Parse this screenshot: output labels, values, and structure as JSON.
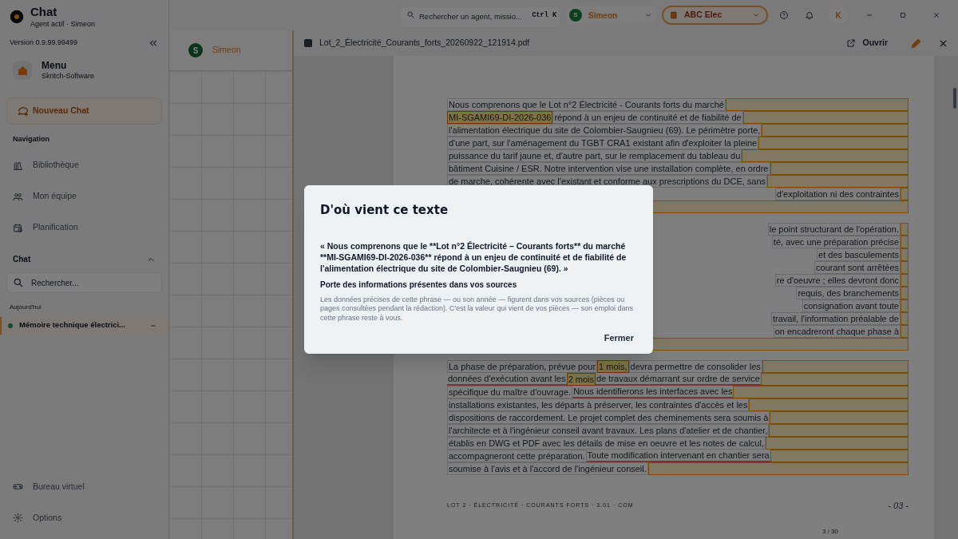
{
  "app": {
    "title": "Chat",
    "subtitle": "Agent actif · Simeon"
  },
  "top_bar": {
    "search": {
      "placeholder": "Rechercher un agent, missio...",
      "shortcut": "Ctrl K"
    },
    "user": {
      "initial": "S",
      "name": "Simeon"
    },
    "organization": {
      "name": "ABC Elec"
    },
    "account_initial": "K"
  },
  "sidebar": {
    "version": "Version 0.9.99.99499",
    "menu": {
      "title": "Menu",
      "subtitle": "Skritch-Software"
    },
    "new_chat": "Nouveau Chat",
    "navigation_label": "Navigation",
    "navigation": [
      {
        "kind": "library",
        "label": "Bibliothèque"
      },
      {
        "kind": "team",
        "label": "Mon équipe"
      },
      {
        "kind": "calendar",
        "label": "Planification"
      }
    ],
    "chat_section": {
      "label": "Chat",
      "expanded": true,
      "search_placeholder": "Rechercher...",
      "group": "Aujourd'hui",
      "conversations": [
        {
          "title": "Mémoire technique électrici...",
          "selected": true
        }
      ]
    },
    "bottom": [
      {
        "kind": "gamepad",
        "label": "Bureau virtuel"
      },
      {
        "kind": "gear",
        "label": "Options"
      }
    ]
  },
  "canvas_panel": {
    "agent": {
      "initial": "S",
      "name": "Simeon"
    }
  },
  "document": {
    "file_name": "Lot_2_Électricité_Courants_forts_20260922_121914.pdf",
    "open_button": "Ouvrir",
    "paragraphs": [
      {
        "lines": [
          {
            "cut_left": false,
            "segments": [
              {
                "kind": "plain",
                "text": "Nous comprenons que le Lot n°2 Électricité - Courants forts du marché"
              }
            ]
          },
          {
            "cut_left": false,
            "segments": [
              {
                "kind": "highlight",
                "text": "MI-SGAMI69-DI-2026-036"
              },
              {
                "kind": "plain",
                "text": " répond à un enjeu de continuité et de fiabilité de"
              }
            ]
          },
          {
            "cut_left": false,
            "segments": [
              {
                "kind": "plain",
                "text": "l'alimentation électrique du site de Colombier-Saugnieu (69). Le périmètre porte,"
              }
            ]
          },
          {
            "cut_left": false,
            "segments": [
              {
                "kind": "plain",
                "text": "d'une part, sur l'aménagement du TGBT CRA1 existant afin d'exploiter la pleine"
              }
            ]
          },
          {
            "cut_left": false,
            "segments": [
              {
                "kind": "plain",
                "text": "puissance du tarif jaune et, d'autre part, sur le remplacement du tableau du"
              }
            ]
          },
          {
            "cut_left": false,
            "segments": [
              {
                "kind": "plain",
                "text": "bâtiment Cuisine / ESR. Notre intervention vise une installation complète, en ordre"
              }
            ]
          },
          {
            "cut_left": false,
            "segments": [
              {
                "kind": "plain",
                "text": "de marche, cohérente avec l'existant et conforme aux prescriptions du DCE, sans"
              }
            ]
          },
          {
            "cut_left": true,
            "segments": [
              {
                "kind": "plain",
                "text": "d'exploitation ni des contraintes"
              }
            ]
          },
          {
            "cut_left": false
          }
        ]
      },
      {
        "lines": [
          {
            "cut_left": true,
            "segments": [
              {
                "kind": "plain",
                "text": "le point structurant de l'opération."
              }
            ]
          },
          {
            "cut_left": true,
            "segments": [
              {
                "kind": "plain",
                "text": "té, avec une préparation précise"
              }
            ]
          },
          {
            "cut_left": true,
            "segments": [
              {
                "kind": "plain",
                "text": "et des basculements"
              }
            ]
          },
          {
            "cut_left": true,
            "segments": [
              {
                "kind": "plain",
                "text": "courant sont arrêtées"
              }
            ]
          },
          {
            "cut_left": true,
            "segments": [
              {
                "kind": "plain",
                "text": "re d'oeuvre ; elles devront donc"
              }
            ]
          },
          {
            "cut_left": true,
            "segments": [
              {
                "kind": "plain",
                "text": "requis, des branchements"
              }
            ]
          },
          {
            "cut_left": true,
            "segments": [
              {
                "kind": "plain",
                "text": "consignation avant toute"
              }
            ]
          },
          {
            "cut_left": true,
            "segments": [
              {
                "kind": "plain",
                "text": "travail, l'information préalable de"
              }
            ]
          },
          {
            "cut_left": true,
            "segments": [
              {
                "kind": "plain",
                "text": "on encadreront chaque phase à"
              }
            ]
          },
          {
            "cut_left": false
          }
        ]
      },
      {
        "lines": [
          {
            "cut_left": false,
            "segments": [
              {
                "kind": "plain",
                "text": "La phase de préparation, prévue pour "
              },
              {
                "kind": "highlight",
                "text": "1 mois,"
              },
              {
                "kind": "plain",
                "text": " devra permettre de consolider les"
              }
            ]
          },
          {
            "cut_left": false,
            "segments": [
              {
                "kind": "underline",
                "text": "données d'exécution avant les "
              },
              {
                "kind": "highlight",
                "text": "2 mois"
              },
              {
                "kind": "underline",
                "text": " de travaux démarrant sur ordre de service"
              }
            ]
          },
          {
            "cut_left": false,
            "segments": [
              {
                "kind": "plain",
                "text": "spécifique du maître d'ouvrage. "
              },
              {
                "kind": "underline",
                "text": "Nous identifierons les interfaces avec les"
              }
            ]
          },
          {
            "cut_left": false,
            "segments": [
              {
                "kind": "plain",
                "text": "installations existantes, les départs à préserver, les contraintes d'accès et les"
              }
            ]
          },
          {
            "cut_left": false,
            "segments": [
              {
                "kind": "plain",
                "text": "dispositions de raccordement. Le projet complet des cheminements sera soumis à"
              }
            ]
          },
          {
            "cut_left": false,
            "segments": [
              {
                "kind": "plain",
                "text": "l'architecte et à l'ingénieur conseil avant travaux. Les plans d'atelier et de chantier,"
              }
            ]
          },
          {
            "cut_left": false,
            "segments": [
              {
                "kind": "plain",
                "text": "établis en DWG et PDF avec les détails de mise en oeuvre et les notes de calcul,"
              }
            ]
          },
          {
            "cut_left": false,
            "segments": [
              {
                "kind": "plain",
                "text": "accompagneront cette préparation. "
              },
              {
                "kind": "underline",
                "text": "Toute modification intervenant en chantier sera"
              }
            ]
          },
          {
            "cut_left": false,
            "segments": [
              {
                "kind": "plain",
                "text": "soumise à l'avis et à l'accord de l'ingénieur conseil."
              }
            ]
          }
        ]
      }
    ],
    "footer": "LOT 2 · ÉLECTRICITÉ · COURANTS FORTS · 3.01 · COM",
    "page_number": "- 03 -",
    "page_counter": "3 / 30"
  },
  "dialog": {
    "title": "D'où vient ce texte",
    "quote": "« Nous comprenons que le **Lot n°2 Électricité – Courants forts** du marché **MI-SGAMI69-DI-2026-036** répond à un enjeu de continuité et de fiabilité de l'alimentation électrique du site de Colombier-Saugnieu (69). »",
    "heading": "Porte des informations présentes dans vos sources",
    "body": "Les données précises de cette phrase — ou son année — figurent dans vos sources (pièces ou pages consultées pendant la rédaction). C'est la valeur qui vient de vos pièces — son emploi dans cette phrase reste à vous.",
    "close_button": "Fermer"
  }
}
